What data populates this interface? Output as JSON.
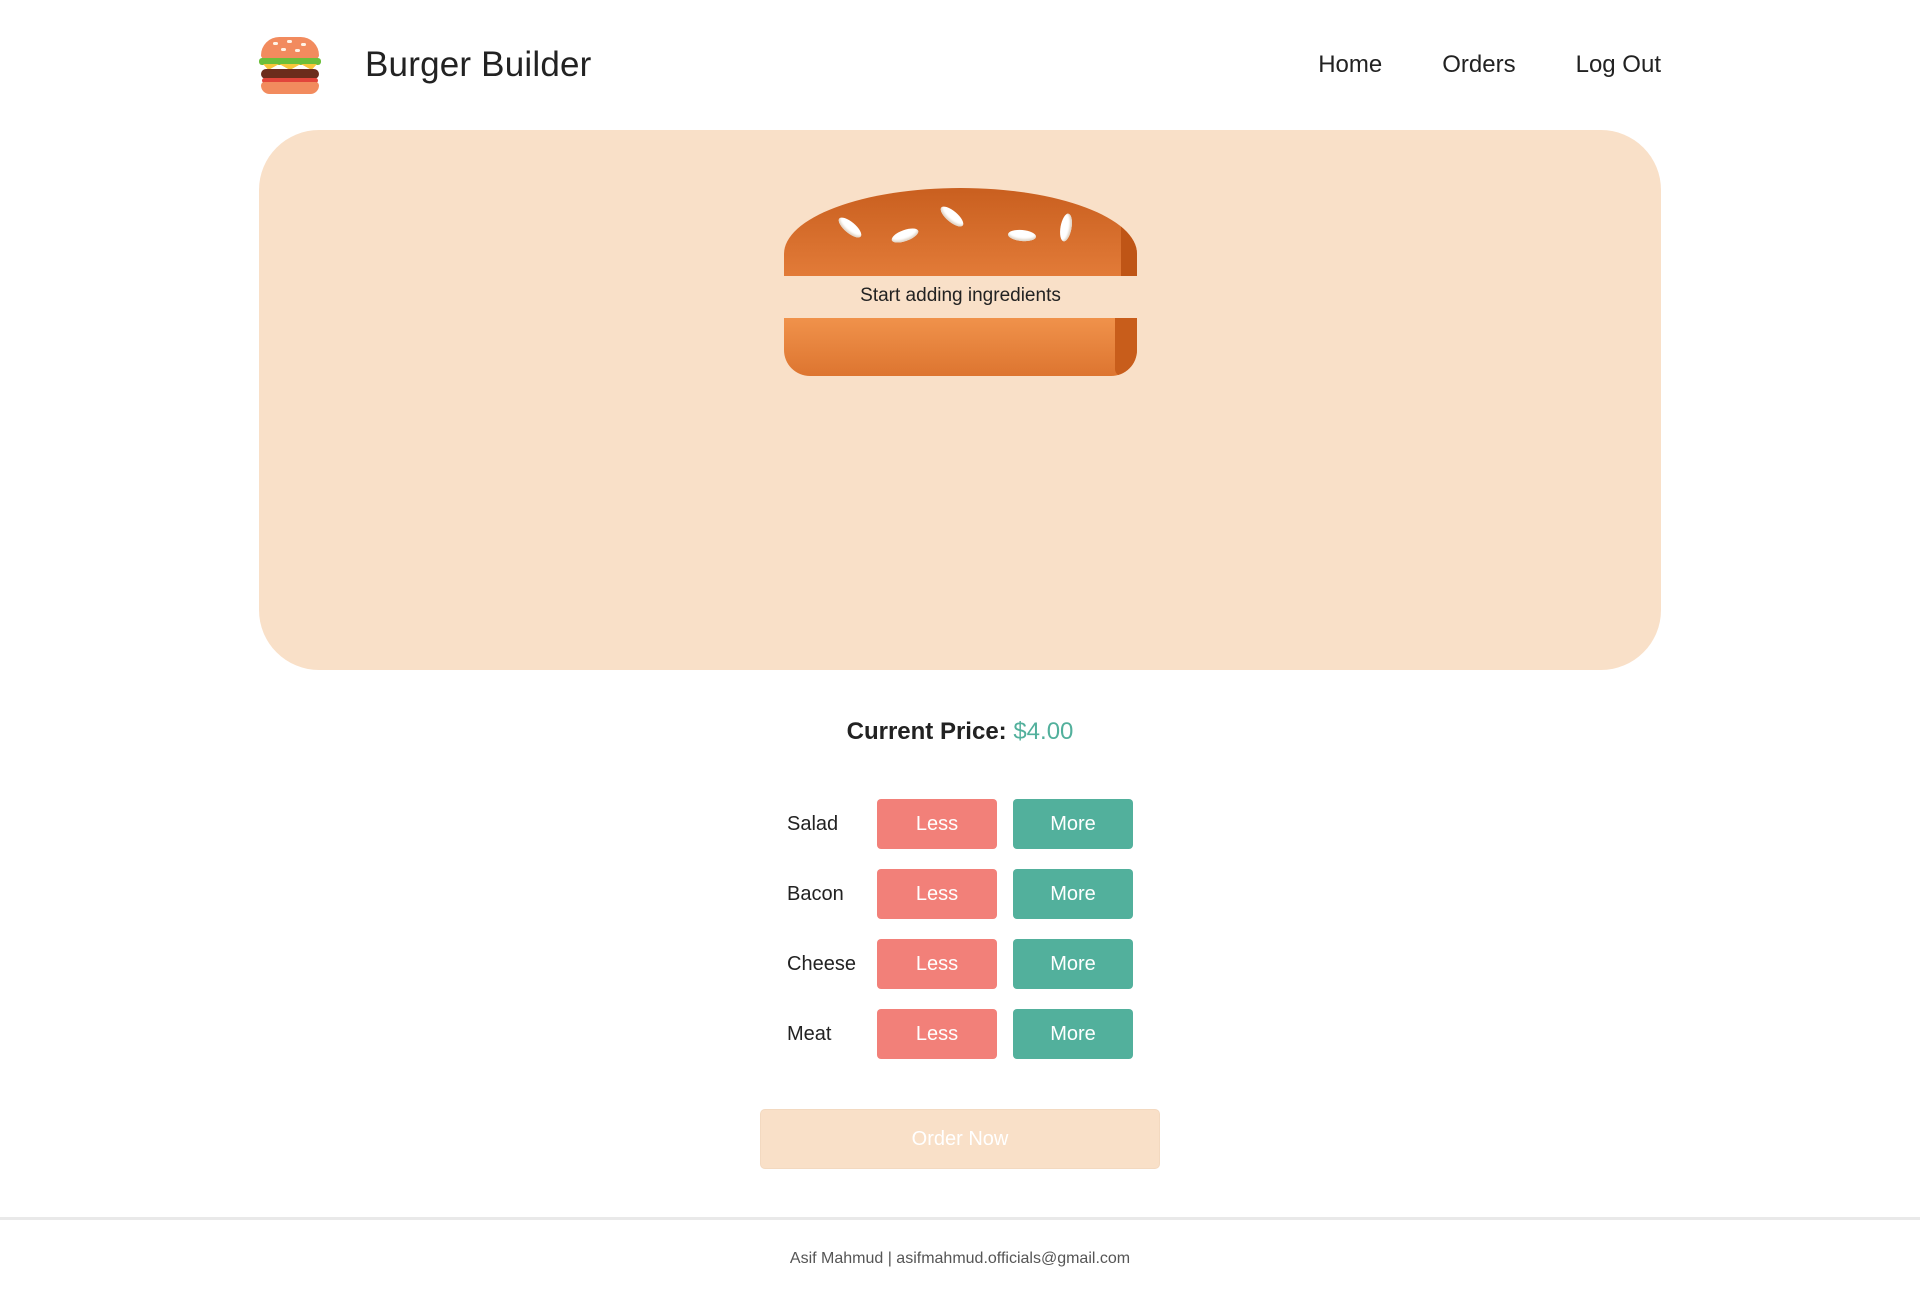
{
  "header": {
    "logo_icon": "burger-logo-icon",
    "title": "Burger Builder",
    "nav": [
      {
        "label": "Home"
      },
      {
        "label": "Orders"
      },
      {
        "label": "Log Out"
      }
    ]
  },
  "burger": {
    "empty_message": "Start adding ingredients",
    "panel_color": "#f9e0c8"
  },
  "price": {
    "label": "Current Price:",
    "value": "$4.00",
    "value_color": "#52b09c"
  },
  "controls": [
    {
      "label": "Salad",
      "less": "Less",
      "more": "More"
    },
    {
      "label": "Bacon",
      "less": "Less",
      "more": "More"
    },
    {
      "label": "Cheese",
      "less": "Less",
      "more": "More"
    },
    {
      "label": "Meat",
      "less": "Less",
      "more": "More"
    }
  ],
  "colors": {
    "less_button": "#f28079",
    "more_button": "#52b09c"
  },
  "order": {
    "label": "Order Now"
  },
  "footer": {
    "text": "Asif Mahmud | asifmahmud.officials@gmail.com"
  }
}
